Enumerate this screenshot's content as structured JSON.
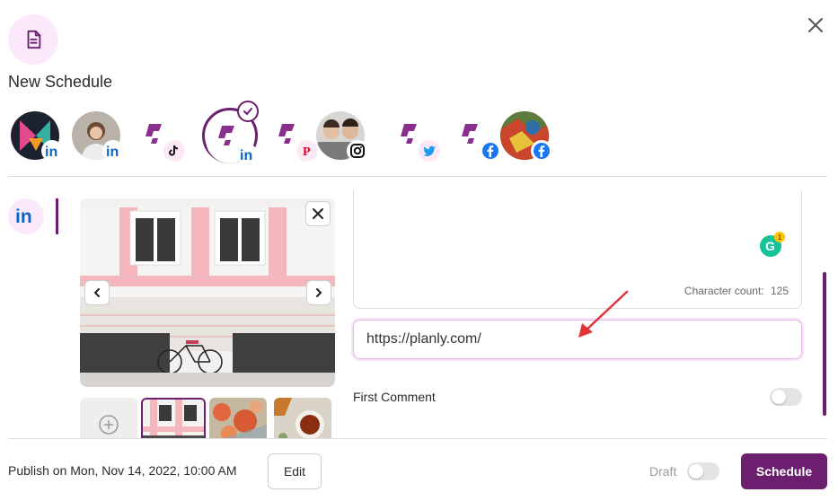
{
  "header": {
    "title": "New Schedule",
    "icon": "document-icon"
  },
  "accounts": [
    {
      "name": "account-1",
      "network": "linkedin",
      "avatar": "logo-avatar"
    },
    {
      "name": "account-2",
      "network": "linkedin",
      "avatar": "photo-avatar"
    },
    {
      "name": "account-3",
      "network": "tiktok",
      "avatar": "planly-logo"
    },
    {
      "name": "account-4",
      "network": "linkedin",
      "avatar": "planly-logo",
      "selected": true
    },
    {
      "name": "account-5",
      "network": "pinterest",
      "avatar": "planly-logo"
    },
    {
      "name": "account-6",
      "network": "instagram",
      "avatar": "photo-avatar"
    },
    {
      "name": "account-7",
      "network": "twitter",
      "avatar": "planly-logo"
    },
    {
      "name": "account-8",
      "network": "facebook",
      "avatar": "planly-logo"
    },
    {
      "name": "account-9",
      "network": "facebook",
      "avatar": "painting-avatar"
    }
  ],
  "editor": {
    "character_count_label": "Character count:",
    "character_count": "125",
    "grammarly_count": "1"
  },
  "url_input": {
    "value": "https://planly.com/"
  },
  "first_comment": {
    "label": "First Comment",
    "enabled": false
  },
  "footer": {
    "publish_text": "Publish on Mon, Nov 14, 2022, 10:00 AM",
    "edit_label": "Edit",
    "draft_label": "Draft",
    "draft_enabled": false,
    "schedule_label": "Schedule"
  },
  "colors": {
    "brand": "#6b1f6e",
    "linkedin": "#0a66c2",
    "facebook": "#1877f2",
    "twitter": "#1d9bf0",
    "pinterest": "#e60023",
    "tiktok": "#000000",
    "accent_red": "#e0343b"
  }
}
